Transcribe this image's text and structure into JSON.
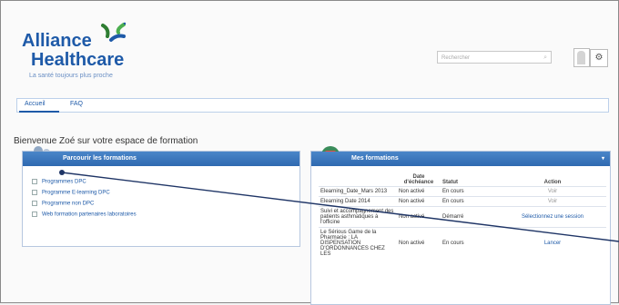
{
  "logo": {
    "word1": "Alliance",
    "word2": "Healthcare",
    "tagline": "La santé toujours plus proche"
  },
  "header": {
    "search_placeholder": "Rechercher"
  },
  "nav": {
    "tabs": [
      "Accueil",
      "FAQ"
    ]
  },
  "welcome": "Bienvenue Zoé sur votre espace de formation",
  "panel_left": {
    "title": "Parcourir les formations",
    "items": [
      "Programmes DPC",
      "Programme E-learning DPC",
      "Programme non DPC",
      "Web formation partenaires laboratoires"
    ]
  },
  "panel_right": {
    "title": "Mes formations",
    "columns": [
      "Date d'échéance",
      "Statut",
      "Action"
    ],
    "rows": [
      {
        "name": "Elearning_Date_Mars 2013",
        "date": "Non activé",
        "status": "En cours",
        "action": "Voir"
      },
      {
        "name": "Elearning Date 2014",
        "date": "Non activé",
        "status": "En cours",
        "action": "Voir"
      },
      {
        "name": "Suivi et accompagnement des patients asthmatiques à l'officine",
        "date": "Non activé",
        "status": "Démarré",
        "action": "Sélectionnez une session"
      },
      {
        "name": "Le Sérious Game de la Pharmacie : LA DISPENSATION D'ORDONNANCES CHEZ LES",
        "date": "Non activé",
        "status": "En cours",
        "action": "Lancer"
      }
    ]
  },
  "colors": {
    "brand": "#1e5aa8",
    "panel_header": "#3a75bd",
    "logo_green": "#4caf50"
  }
}
